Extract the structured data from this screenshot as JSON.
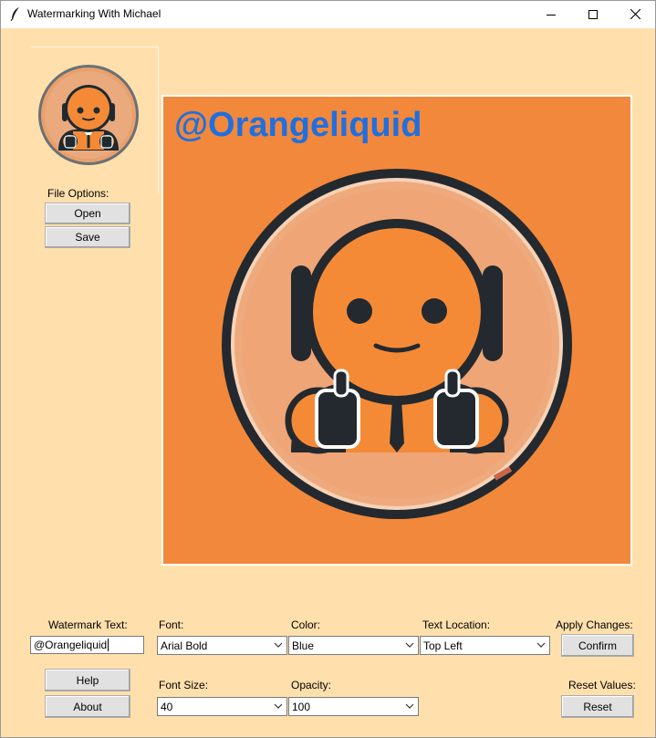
{
  "window": {
    "title": "Watermarking With Michael",
    "icon": "feather-icon",
    "controls": [
      "minimize-icon",
      "maximize-icon",
      "close-icon"
    ]
  },
  "sidebar": {
    "file_options_label": "File Options:",
    "open_label": "Open",
    "save_label": "Save",
    "help_label": "Help",
    "about_label": "About"
  },
  "preview": {
    "watermark_text": "@Orangeliquid",
    "background_color": "#f2883b",
    "watermark_color": "#1f6fe0"
  },
  "controls": {
    "watermark_text_label": "Watermark Text:",
    "watermark_text_value": "@Orangeliquid",
    "font_label": "Font:",
    "font_value": "Arial Bold",
    "color_label": "Color:",
    "color_value": "Blue",
    "text_location_label": "Text Location:",
    "text_location_value": "Top Left",
    "apply_changes_label": "Apply Changes:",
    "confirm_label": "Confirm",
    "font_size_label": "Font Size:",
    "font_size_value": "40",
    "opacity_label": "Opacity:",
    "opacity_value": "100",
    "reset_values_label": "Reset Values:",
    "reset_label": "Reset"
  },
  "colors": {
    "client_background": "#ffe0ad",
    "accent_orange": "#f2883b",
    "dark": "#1e2a30"
  }
}
